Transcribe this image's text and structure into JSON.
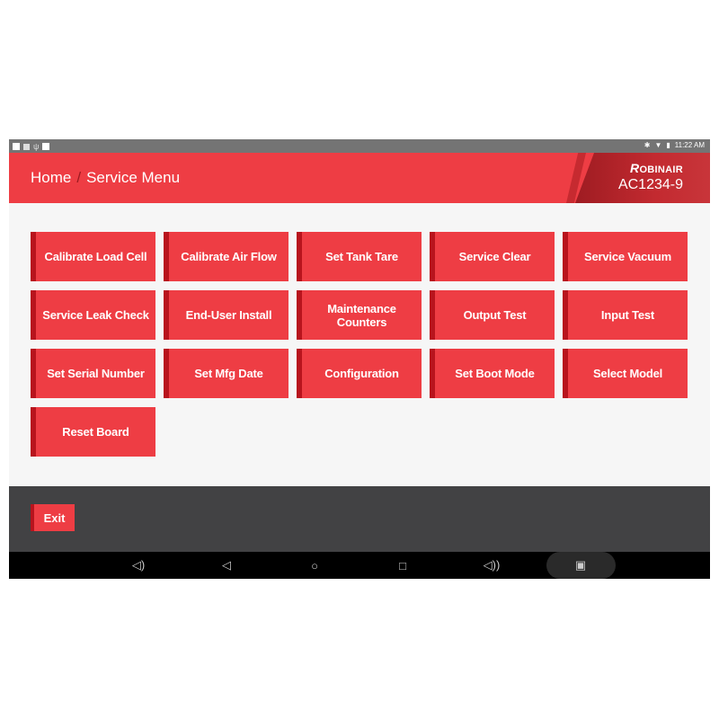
{
  "status_bar": {
    "left_icons": [
      "notification-square-icon",
      "image-icon",
      "usb-icon",
      "notification-square-icon"
    ],
    "right_icons": [
      "bluetooth-icon",
      "wifi-icon",
      "battery-icon"
    ],
    "time": "11:22 AM"
  },
  "header": {
    "breadcrumb": [
      {
        "label": "Home"
      },
      {
        "label": "Service Menu"
      }
    ],
    "separator": "/",
    "brand": {
      "name_first": "R",
      "name_rest": "OBINAIR",
      "model": "AC1234-9"
    }
  },
  "menu": {
    "buttons": [
      {
        "label": "Calibrate Load Cell"
      },
      {
        "label": "Calibrate Air Flow"
      },
      {
        "label": "Set Tank Tare"
      },
      {
        "label": "Service Clear"
      },
      {
        "label": "Service Vacuum"
      },
      {
        "label": "Service Leak Check"
      },
      {
        "label": "End-User Install"
      },
      {
        "label": "Maintenance Counters"
      },
      {
        "label": "Output Test"
      },
      {
        "label": "Input Test"
      },
      {
        "label": "Set Serial Number"
      },
      {
        "label": "Set Mfg Date"
      },
      {
        "label": "Configuration"
      },
      {
        "label": "Set Boot Mode"
      },
      {
        "label": "Select Model"
      },
      {
        "label": "Reset Board"
      }
    ]
  },
  "footer": {
    "exit_label": "Exit"
  },
  "nav_bar": {
    "icons": {
      "volume_down": "◁)",
      "back": "◁",
      "home": "○",
      "recents": "□",
      "volume_up": "◁))",
      "screenshot": "▣"
    }
  },
  "colors": {
    "accent": "#ee3d44",
    "accent_dark": "#b8141d",
    "footer_bg": "#424244",
    "content_bg": "#f6f6f6"
  }
}
